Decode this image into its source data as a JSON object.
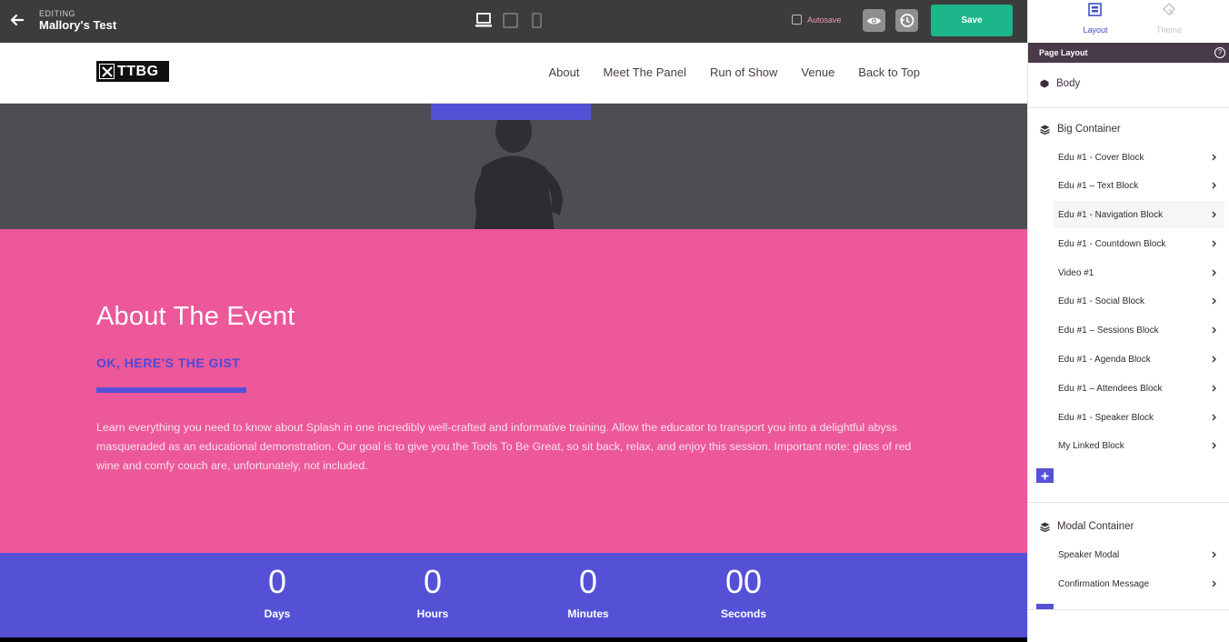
{
  "editor": {
    "editing_label": "EDITING",
    "project_name": "Mallory's Test",
    "autosave_label": "Autosave",
    "save_label": "Save"
  },
  "site": {
    "logo_text": "TTBG",
    "nav": [
      "About",
      "Meet The Panel",
      "Run of Show",
      "Venue",
      "Back to Top"
    ],
    "about": {
      "title": "About The Event",
      "subtitle": "OK, HERE'S THE GIST",
      "body": "Learn everything you need to know about Splash in one incredibly well-crafted and informative training. Allow the educator to transport you into a delightful abyss masqueraded as an educational demonstration. Our goal is to give you the Tools To Be Great, so sit back, relax, and enjoy this session. Important note: glass of red wine and comfy couch are, unfortunately, not included."
    },
    "countdown": [
      {
        "value": "0",
        "label": "Days"
      },
      {
        "value": "0",
        "label": "Hours"
      },
      {
        "value": "0",
        "label": "Minutes"
      },
      {
        "value": "00",
        "label": "Seconds"
      }
    ]
  },
  "panel": {
    "tabs": {
      "layout": "Layout",
      "theme": "Theme"
    },
    "section_title": "Page Layout",
    "body_label": "Body",
    "big_container": {
      "label": "Big Container",
      "items": [
        "Edu #1 - Cover Block",
        "Edu #1 – Text Block",
        "Edu #1 - Navigation Block",
        "Edu #1 - Countdown Block",
        "Video #1",
        "Edu #1 - Social Block",
        "Edu #1 – Sessions Block",
        "Edu #1 - Agenda Block",
        "Edu #1 – Attendees Block",
        "Edu #1 - Speaker Block",
        "My Linked Block"
      ]
    },
    "modal_container": {
      "label": "Modal Container",
      "items": [
        "Speaker Modal",
        "Confirmation Message"
      ]
    }
  },
  "colors": {
    "topbar": "#3c3c3c",
    "save": "#1db68a",
    "pink": "#ec5899",
    "purple": "#5451d6",
    "panel_header": "#493a49"
  }
}
